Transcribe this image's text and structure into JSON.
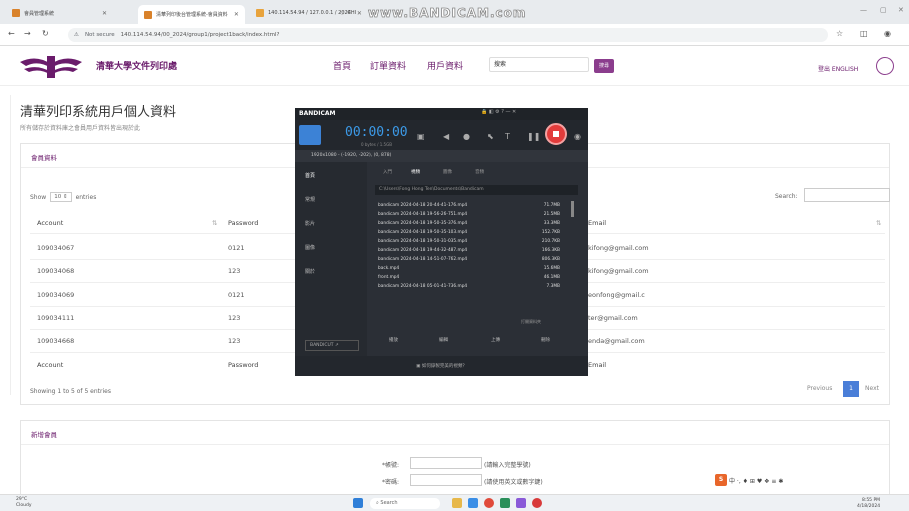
{
  "browser": {
    "tabs": [
      {
        "label": "會員管理系統",
        "color": "#d9822b"
      },
      {
        "label": "清華列印後台管理系統-會員資料",
        "color": "#d9822b"
      },
      {
        "label": "140.114.54.94 / 127.0.0.1 / 2024",
        "color": "#e8a33c"
      },
      {
        "label": "CHI",
        "color": "#555555"
      }
    ],
    "watermark": "www.BANDICAM.com",
    "url_security": "Not secure",
    "url": "140.114.54.94/00_2024/group1/project1back/index.html?"
  },
  "site": {
    "title": "清華大學文件列印處",
    "nav": [
      "首頁",
      "訂單資料",
      "用戶資料"
    ],
    "search_placeholder": "搜索",
    "search_button": "搜尋",
    "login_lang": "登出 ENGLISH",
    "brand_color": "#6a1b6b"
  },
  "page": {
    "title": "清華列印系統用戶個人資料",
    "subtitle": "所有儲存於資料庫之會員用戶資料皆出現於此"
  },
  "members_card": {
    "heading": "會員資料",
    "show_label": "Show",
    "show_value": "10",
    "entries_label": "entries",
    "search_label": "Search:",
    "columns": [
      "Account",
      "Password",
      "Email"
    ],
    "rows": [
      {
        "account": "109034067",
        "password": "0121",
        "email": "kifong@gmail.com"
      },
      {
        "account": "109034068",
        "password": "123",
        "email": "kifong@gmail.com"
      },
      {
        "account": "109034069",
        "password": "0121",
        "email": "eonfong@gmail.c"
      },
      {
        "account": "109034111",
        "password": "123",
        "email": "ter@gmail.com"
      },
      {
        "account": "109034668",
        "password": "123",
        "email": "enda@gmail.com"
      }
    ],
    "footer_columns": [
      "Account",
      "Password",
      "Email"
    ],
    "info": "Showing 1 to 5 of 5 entries",
    "pager": {
      "previous": "Previous",
      "current": "1",
      "next": "Next"
    }
  },
  "new_member_card": {
    "heading": "新增會員",
    "fields": [
      {
        "label": "*帳號:",
        "hint": "(請輸入完整學號)"
      },
      {
        "label": "*密碼:",
        "hint": "(請使用英文或數字鍵)"
      }
    ]
  },
  "bandicam": {
    "brand": "BANDICAM",
    "timer": "00:00:00",
    "size": "0 bytes / 1.5GB",
    "resolution": "1920x1080 - (-1920, -202), (0, 878)",
    "sidebar": [
      "首頁",
      "常規",
      "影片",
      "圖像",
      "關於"
    ],
    "tabs": [
      "入門",
      "視頻",
      "圖像",
      "音頻"
    ],
    "path": "C:\\Users\\Fong Hong Ten\\Documents\\Bandicam",
    "files": [
      {
        "name": "bandicam 2024-04-18 20-44-41-176.mp4",
        "size": "71.7MB"
      },
      {
        "name": "bandicam 2024-04-18 19-56-26-751.mp4",
        "size": "21.5MB"
      },
      {
        "name": "bandicam 2024-04-18 19-50-35-376.mp4",
        "size": "33.3MB"
      },
      {
        "name": "bandicam 2024-04-18 19-50-35-103.mp4",
        "size": "152.7KB"
      },
      {
        "name": "bandicam 2024-04-18 19-50-31-035.mp4",
        "size": "210.7KB"
      },
      {
        "name": "bandicam 2024-04-18 19-44-32-487.mp4",
        "size": "166.3KB"
      },
      {
        "name": "bandicam 2024-04-18 14-51-07-762.mp4",
        "size": "806.3KB"
      },
      {
        "name": "back.mp4",
        "size": "15.6MB"
      },
      {
        "name": "front.mp4",
        "size": "46.1MB"
      },
      {
        "name": "bandicam 2024-04-18 05-01-41-736.mp4",
        "size": "7.3MB"
      }
    ],
    "open_label": "打開資料夾",
    "actions": [
      "播放",
      "編輯",
      "上傳",
      "刪除"
    ],
    "ad_label": "BANDICUT ↗",
    "footer": "如何錄製完美的視頻？"
  },
  "taskbar": {
    "weather_temp": "29°C",
    "weather_desc": "Cloudy",
    "search": "Search",
    "time": "8:55 PM",
    "date": "4/18/2024"
  }
}
